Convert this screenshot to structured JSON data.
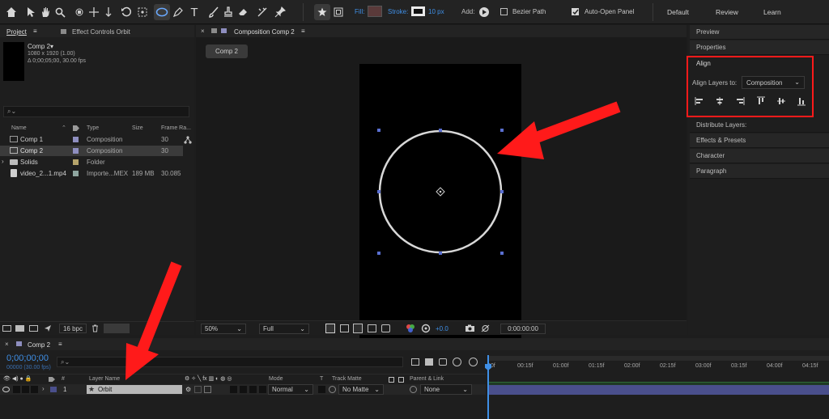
{
  "toolbar": {
    "fill_label": "Fill:",
    "stroke_label": "Stroke:",
    "stroke_value": "10 px",
    "add_label": "Add:",
    "bezier_label": "Bezier Path",
    "auto_open_label": "Auto-Open Panel",
    "workspaces": [
      "Default",
      "Review",
      "Learn"
    ],
    "fill_color": "#5a3a3a"
  },
  "project": {
    "tabs": [
      "Project",
      "Effect Controls Orbit"
    ],
    "comp_name": "Comp 2▾",
    "comp_dims": "1080 x 1920 (1.00)",
    "comp_dur": "Δ 0;00;05;00, 30.00 fps",
    "search_placeholder": "⌕⌄",
    "columns": [
      "Name",
      "Type",
      "Size",
      "Frame Ra..."
    ],
    "items": [
      {
        "name": "Comp 1",
        "type": "Composition",
        "size": "",
        "fps": "30"
      },
      {
        "name": "Comp 2",
        "type": "Composition",
        "size": "",
        "fps": "30"
      },
      {
        "name": "Solids",
        "type": "Folder",
        "size": "",
        "fps": ""
      },
      {
        "name": "video_2...1.mp4",
        "type": "Importe...MEX",
        "size": "189 MB",
        "fps": "30.085"
      }
    ],
    "bpc": "16 bpc"
  },
  "composition": {
    "tab_title": "Composition Comp 2",
    "breadcrumb": "Comp 2",
    "zoom": "50%",
    "resolution": "Full",
    "exposure": "+0.0",
    "timecode": "0:00:00:00"
  },
  "right_panels": {
    "preview": "Preview",
    "properties": "Properties",
    "align": "Align",
    "align_layers_to": "Align Layers to:",
    "align_target": "Composition",
    "distribute": "Distribute Layers:",
    "effects": "Effects & Presets",
    "character": "Character",
    "paragraph": "Paragraph"
  },
  "timeline": {
    "tab": "Comp 2",
    "timecode": "0;00;00;00",
    "frames": "00000 (30.00 fps)",
    "search_placeholder": "⌕⌄",
    "columns": [
      "Layer Name",
      "Mode",
      "T",
      "Track Matte",
      "Parent & Link"
    ],
    "layer_num": "1",
    "layer_name": "Orbit",
    "mode": "Normal",
    "matte": "No Matte",
    "parent": "None",
    "ruler": [
      "00f",
      "00:15f",
      "01:00f",
      "01:15f",
      "02:00f",
      "02:15f",
      "03:00f",
      "03:15f",
      "04:00f",
      "04:15f"
    ]
  },
  "colors": {
    "accent": "#3f8fe6",
    "annotation": "#ff1a1a",
    "layer_bar": "#4a4f8c",
    "label_lavender": "#8e8ebf",
    "label_tan": "#b5a36b"
  }
}
